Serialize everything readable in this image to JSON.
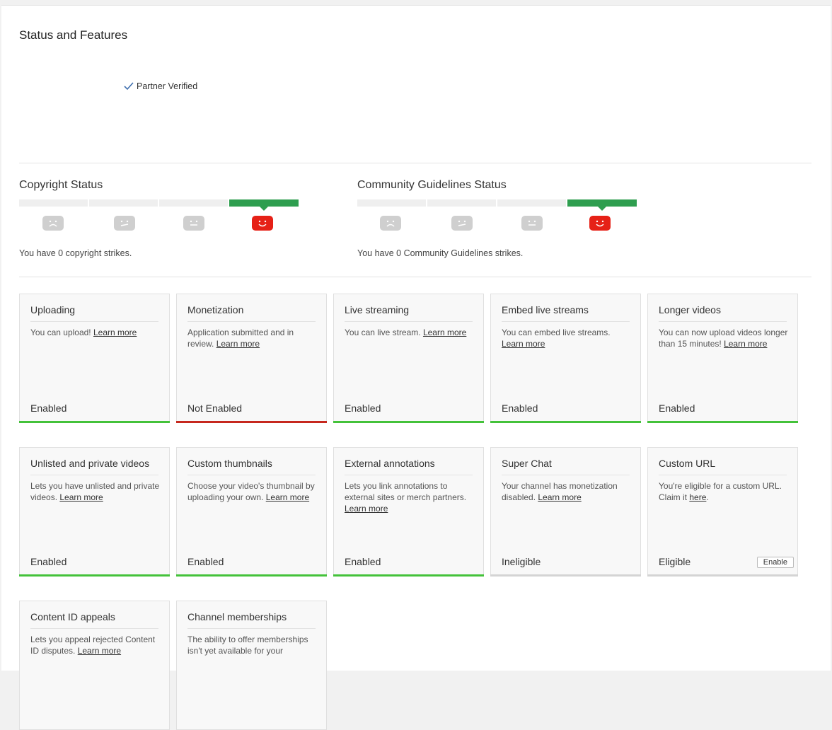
{
  "page": {
    "title": "Status and Features",
    "partner_verified": "Partner Verified"
  },
  "copyright": {
    "title": "Copyright Status",
    "strikes_text": "You have 0 copyright strikes.",
    "active_segment": 3
  },
  "community": {
    "title": "Community Guidelines Status",
    "strikes_text": "You have 0 Community Guidelines strikes.",
    "active_segment": 3
  },
  "colors": {
    "enabled": "#44c23a",
    "not_enabled": "#c6281e",
    "ineligible": "#d4d4d4",
    "meter_active": "#2e9e4f",
    "face_active": "#e62117"
  },
  "features": [
    {
      "title": "Uploading",
      "desc": "You can upload!",
      "link": "Learn more",
      "suffix": "",
      "status": "Enabled",
      "bar": "green"
    },
    {
      "title": "Monetization",
      "desc": "Application submitted and in review.",
      "link": "Learn more",
      "suffix": "",
      "status": "Not Enabled",
      "bar": "red"
    },
    {
      "title": "Live streaming",
      "desc": "You can live stream.",
      "link": "Learn more",
      "suffix": "",
      "status": "Enabled",
      "bar": "green"
    },
    {
      "title": "Embed live streams",
      "desc": "You can embed live streams.",
      "link": "Learn more",
      "suffix": "",
      "status": "Enabled",
      "bar": "green"
    },
    {
      "title": "Longer videos",
      "desc": "You can now upload videos longer than 15 minutes!",
      "link": "Learn more",
      "suffix": "",
      "status": "Enabled",
      "bar": "green"
    },
    {
      "title": "Unlisted and private videos",
      "desc": "Lets you have unlisted and private videos.",
      "link": "Learn more",
      "suffix": "",
      "status": "Enabled",
      "bar": "green"
    },
    {
      "title": "Custom thumbnails",
      "desc": "Choose your video's thumbnail by uploading your own.",
      "link": "Learn more",
      "suffix": "",
      "status": "Enabled",
      "bar": "green"
    },
    {
      "title": "External annotations",
      "desc": "Lets you link annotations to external sites or merch partners.",
      "link": "Learn more",
      "suffix": "",
      "status": "Enabled",
      "bar": "green"
    },
    {
      "title": "Super Chat",
      "desc": "Your channel has monetization disabled.",
      "link": "Learn more",
      "suffix": "",
      "status": "Ineligible",
      "bar": "gray"
    },
    {
      "title": "Custom URL",
      "desc": "You're eligible for a custom URL. Claim it",
      "link": "here",
      "suffix": ".",
      "status": "Eligible",
      "bar": "gray",
      "button": "Enable"
    },
    {
      "title": "Content ID appeals",
      "desc": "Lets you appeal rejected Content ID disputes.",
      "link": "Learn more",
      "suffix": "",
      "status": "",
      "bar": ""
    },
    {
      "title": "Channel memberships",
      "desc": "The ability to offer memberships isn't yet available for your",
      "link": "",
      "suffix": "",
      "status": "",
      "bar": ""
    }
  ]
}
